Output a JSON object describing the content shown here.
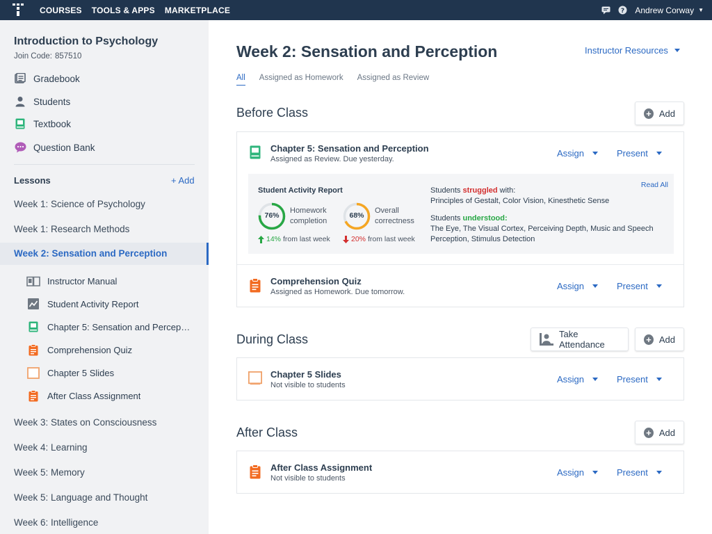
{
  "topbar": {
    "nav": [
      "COURSES",
      "TOOLS & APPS",
      "MARKETPLACE"
    ],
    "user_name": "Andrew Corway",
    "icons": [
      "chat-icon",
      "help-icon"
    ]
  },
  "sidebar": {
    "course_title": "Introduction to Psychology",
    "join_code_label": "Join Code:",
    "join_code": "857510",
    "links": [
      {
        "label": "Gradebook",
        "icon": "gradebook-icon"
      },
      {
        "label": "Students",
        "icon": "students-icon"
      },
      {
        "label": "Textbook",
        "icon": "textbook-icon"
      },
      {
        "label": "Question Bank",
        "icon": "question-bank-icon"
      }
    ],
    "lessons_label": "Lessons",
    "lessons_add": "+ Add",
    "weeks_before": [
      "Week 1: Science of Psychology",
      "Week 1: Research Methods"
    ],
    "active_week": "Week 2: Sensation and Perception",
    "sub_items": [
      {
        "label": "Instructor Manual",
        "icon": "manual-icon"
      },
      {
        "label": "Student Activity Report",
        "icon": "report-icon"
      },
      {
        "label": "Chapter 5: Sensation and Percep…",
        "icon": "book-icon"
      },
      {
        "label": "Comprehension Quiz",
        "icon": "quiz-icon"
      },
      {
        "label": "Chapter 5 Slides",
        "icon": "slides-icon"
      },
      {
        "label": "After Class Assignment",
        "icon": "assignment-icon"
      }
    ],
    "weeks_after": [
      "Week 3: States on Consciousness",
      "Week 4: Learning",
      "Week 5: Memory",
      "Week 5: Language and Thought",
      "Week 6: Intelligence"
    ]
  },
  "main": {
    "title": "Week 2: Sensation and Perception",
    "instructor_resources": "Instructor Resources",
    "tabs": [
      "All",
      "Assigned as Homework",
      "Assigned as Review"
    ],
    "add_label": "Add",
    "assign_label": "Assign",
    "present_label": "Present",
    "take_attendance": "Take Attendance",
    "before_class": {
      "title": "Before Class",
      "items": [
        {
          "title": "Chapter 5: Sensation and Perception",
          "subtitle": "Assigned as Review. Due yesterday."
        },
        {
          "title": "Comprehension Quiz",
          "subtitle": "Assigned as Homework. Due tomorrow."
        }
      ]
    },
    "report": {
      "title": "Student Activity Report",
      "read_all": "Read All",
      "homework": {
        "pct": "76%",
        "value": 0.76,
        "label1": "Homework",
        "label2": "completion",
        "delta": "14%",
        "delta_suffix": "from last week",
        "color": "#28a745"
      },
      "correctness": {
        "pct": "68%",
        "value": 0.68,
        "label1": "Overall",
        "label2": "correctness",
        "delta": "20%",
        "delta_suffix": "from last week",
        "color": "#f5a623"
      },
      "struggled_prefix": "Students",
      "struggled_kw": "struggled",
      "struggled_suffix": "with:",
      "struggled_topics": "Principles of Gestalt, Color Vision, Kinesthetic Sense",
      "understood_prefix": "Students",
      "understood_kw": "understood:",
      "understood_topics_1": "The Eye, The Visual Cortex, Perceiving Depth, Music and Speech",
      "understood_topics_2": "Perception, Stimulus Detection"
    },
    "during_class": {
      "title": "During Class",
      "items": [
        {
          "title": "Chapter 5 Slides",
          "subtitle": "Not visible to students"
        }
      ]
    },
    "after_class": {
      "title": "After Class",
      "items": [
        {
          "title": "After Class Assignment",
          "subtitle": "Not visible to students"
        }
      ]
    }
  }
}
